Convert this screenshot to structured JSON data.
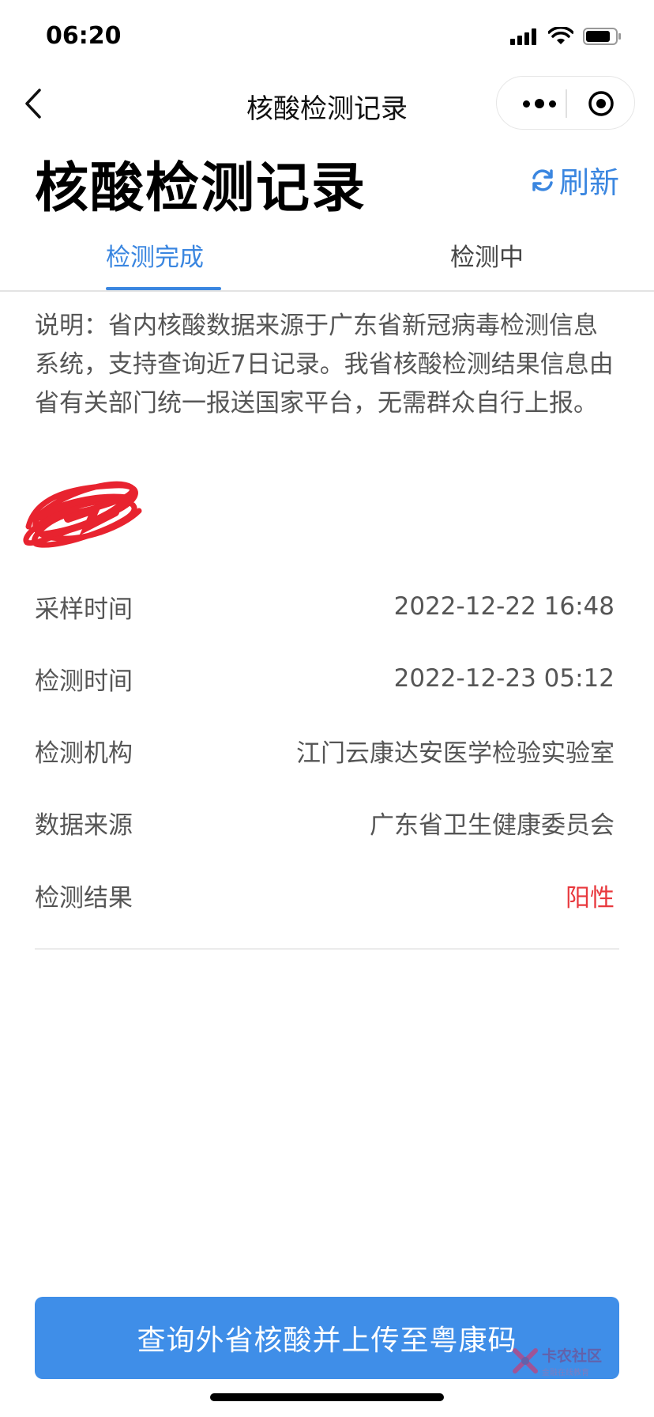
{
  "status_bar": {
    "time": "06:20"
  },
  "nav": {
    "title": "核酸检测记录"
  },
  "header": {
    "title": "核酸检测记录",
    "refresh_label": "刷新"
  },
  "tabs": [
    {
      "label": "检测完成",
      "active": true
    },
    {
      "label": "检测中",
      "active": false
    }
  ],
  "note": "说明：省内核酸数据来源于广东省新冠病毒检测信息系统，支持查询近7日记录。我省核酸检测结果信息由省有关部门统一报送国家平台，无需群众自行上报。",
  "record": {
    "rows": [
      {
        "label": "采样时间",
        "value": "2022-12-22 16:48"
      },
      {
        "label": "检测时间",
        "value": "2022-12-23 05:12"
      },
      {
        "label": "检测机构",
        "value": "江门云康达安医学检验实验室"
      },
      {
        "label": "数据来源",
        "value": "广东省卫生健康委员会"
      },
      {
        "label": "检测结果",
        "value": "阳性"
      }
    ]
  },
  "cta": {
    "label": "查询外省核酸并上传至粤康码"
  },
  "watermark": {
    "title": "卡农社区",
    "subtitle": "金融在线教育"
  },
  "colors": {
    "accent": "#3a86e0",
    "button": "#3f8ee8",
    "positive_result": "#e8383d"
  }
}
